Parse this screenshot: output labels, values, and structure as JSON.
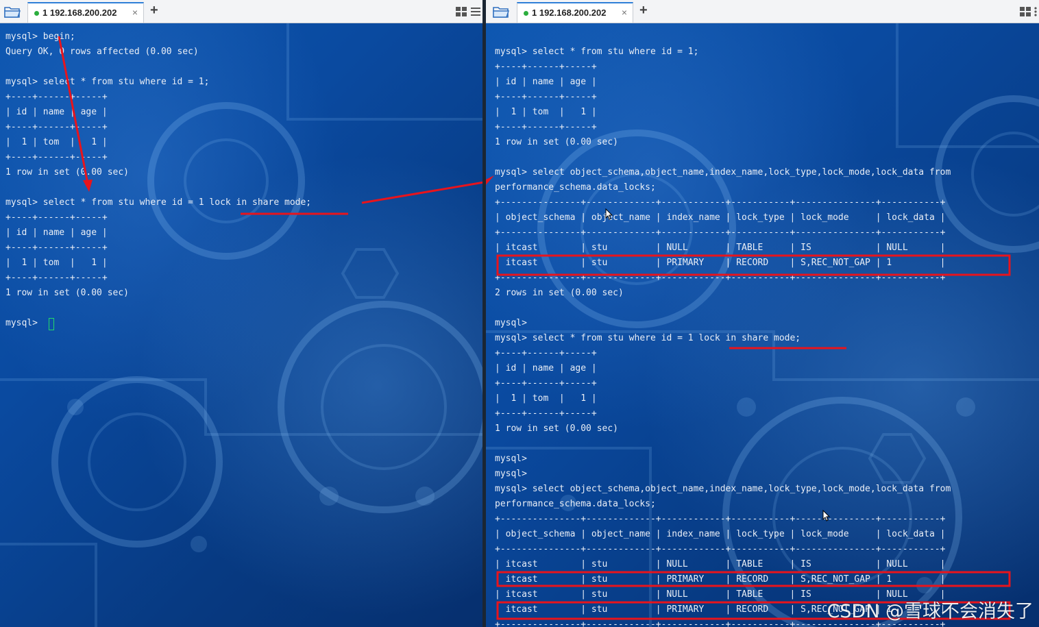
{
  "left_pane": {
    "tab": {
      "title": "1 192.168.200.202",
      "close": "×",
      "status_color": "#2cae3e"
    },
    "add_tab": "+",
    "terminal_lines": [
      "mysql> begin;",
      "Query OK, 0 rows affected (0.00 sec)",
      "",
      "mysql> select * from stu where id = 1;",
      "+----+------+-----+",
      "| id | name | age |",
      "+----+------+-----+",
      "|  1 | tom  |   1 |",
      "+----+------+-----+",
      "1 row in set (0.00 sec)",
      "",
      "mysql> select * from stu where id = 1 lock in share mode;",
      "+----+------+-----+",
      "| id | name | age |",
      "+----+------+-----+",
      "|  1 | tom  |   1 |",
      "+----+------+-----+",
      "1 row in set (0.00 sec)",
      "",
      "mysql> "
    ]
  },
  "right_pane": {
    "tab": {
      "title": "1 192.168.200.202",
      "close": "×",
      "status_color": "#2cae3e"
    },
    "add_tab": "+",
    "terminal_lines": [
      "mysql> select * from stu where id = 1;",
      "+----+------+-----+",
      "| id | name | age |",
      "+----+------+-----+",
      "|  1 | tom  |   1 |",
      "+----+------+-----+",
      "1 row in set (0.00 sec)",
      "",
      "mysql> select object_schema,object_name,index_name,lock_type,lock_mode,lock_data from",
      "performance_schema.data_locks;",
      "+---------------+-------------+------------+-----------+---------------+-----------+",
      "| object_schema | object_name | index_name | lock_type | lock_mode     | lock_data |",
      "+---------------+-------------+------------+-----------+---------------+-----------+",
      "| itcast        | stu         | NULL       | TABLE     | IS            | NULL      |",
      "| itcast        | stu         | PRIMARY    | RECORD    | S,REC_NOT_GAP | 1         |",
      "+---------------+-------------+------------+-----------+---------------+-----------+",
      "2 rows in set (0.00 sec)",
      "",
      "mysql>",
      "mysql> select * from stu where id = 1 lock in share mode;",
      "+----+------+-----+",
      "| id | name | age |",
      "+----+------+-----+",
      "|  1 | tom  |   1 |",
      "+----+------+-----+",
      "1 row in set (0.00 sec)",
      "",
      "mysql>",
      "mysql>",
      "mysql> select object_schema,object_name,index_name,lock_type,lock_mode,lock_data from",
      "performance_schema.data_locks;",
      "+---------------+-------------+------------+-----------+---------------+-----------+",
      "| object_schema | object_name | index_name | lock_type | lock_mode     | lock_data |",
      "+---------------+-------------+------------+-----------+---------------+-----------+",
      "| itcast        | stu         | NULL       | TABLE     | IS            | NULL      |",
      "| itcast        | stu         | PRIMARY    | RECORD    | S,REC_NOT_GAP | 1         |",
      "| itcast        | stu         | NULL       | TABLE     | IS            | NULL      |",
      "| itcast        | stu         | PRIMARY    | RECORD    | S,REC_NOT_GAP | 1         |",
      "+---------------+-------------+------------+-----------+---------------+-----------+"
    ]
  },
  "watermark": "CSDN @雪球不会消失了",
  "colors": {
    "annotation_red": "#e8141c",
    "terminal_text": "#e9eef6",
    "cursor_green": "#22d86a",
    "tab_accent": "#2f7fd8"
  },
  "icons": [
    "folder-icon",
    "layout-icon",
    "menu-icon",
    "status-dot-icon",
    "close-icon",
    "add-tab-icon",
    "mouse-pointer-icon"
  ]
}
